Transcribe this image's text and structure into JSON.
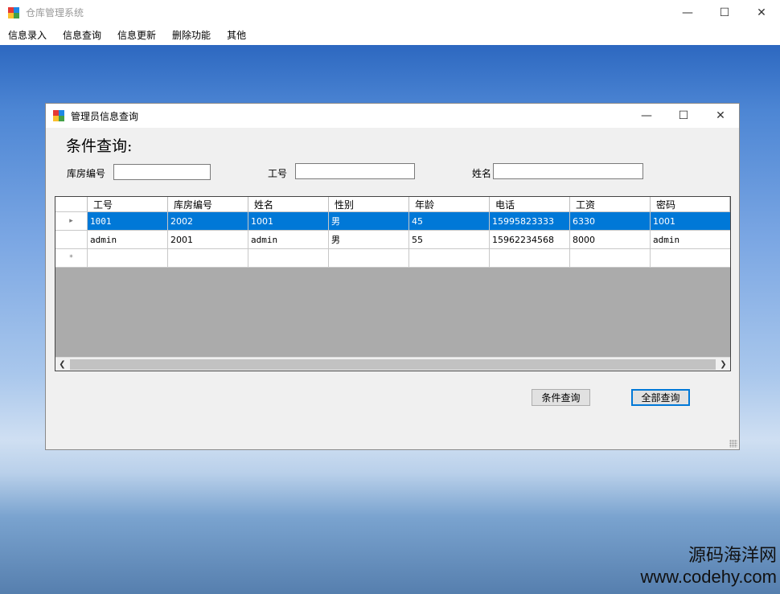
{
  "main_window": {
    "title": "仓库管理系统",
    "controls": {
      "minimize": "—",
      "maximize": "☐",
      "close": "✕"
    }
  },
  "menu": [
    "信息录入",
    "信息查询",
    "信息更新",
    "删除功能",
    "其他"
  ],
  "child_window": {
    "title": "管理员信息查询",
    "controls": {
      "minimize": "—",
      "maximize": "☐",
      "close": "✕"
    },
    "condition_label": "条件查询:",
    "fields": {
      "warehouse_label": "库房编号",
      "warehouse_value": "",
      "job_label": "工号",
      "job_value": "",
      "name_label": "姓名",
      "name_value": ""
    },
    "grid": {
      "columns": [
        "工号",
        "库房编号",
        "姓名",
        "性别",
        "年龄",
        "电话",
        "工资",
        "密码"
      ],
      "rows": [
        [
          "1001",
          "2002",
          "1001",
          "男",
          "45",
          "15995823333",
          "6330",
          "1001"
        ],
        [
          "admin",
          "2001",
          "admin",
          "男",
          "55",
          "15962234568",
          "8000",
          "admin"
        ]
      ],
      "row_marker_current": "▸",
      "row_marker_new": "*"
    },
    "buttons": {
      "conditional_query": "条件查询",
      "query_all": "全部查询"
    }
  },
  "watermark": {
    "line1": "源码海洋网",
    "line2": "www.codehy.com"
  }
}
